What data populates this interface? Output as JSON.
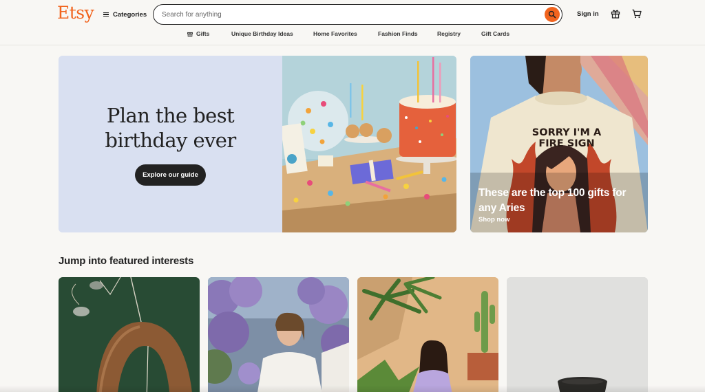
{
  "header": {
    "logo": "Etsy",
    "categories_label": "Categories",
    "search_placeholder": "Search for anything",
    "signin_label": "Sign in"
  },
  "nav": {
    "items": [
      "Gifts",
      "Unique Birthday Ideas",
      "Home Favorites",
      "Fashion Finds",
      "Registry",
      "Gift Cards"
    ]
  },
  "hero": {
    "title_line1": "Plan the best",
    "title_line2": "birthday ever",
    "button_label": "Explore our guide"
  },
  "promo": {
    "shirt_line1": "SORRY I'M A",
    "shirt_line2": "FIRE SIGN",
    "title": "These are the top 100 gifts for any Aries",
    "link_label": "Shop now"
  },
  "featured": {
    "title": "Jump into featured interests"
  },
  "colors": {
    "brand": "#f1641e",
    "hero_bg": "#d9e0f1",
    "button_dark": "#222222"
  },
  "icons": [
    "menu-icon",
    "search-icon",
    "gift-icon",
    "cart-icon"
  ]
}
